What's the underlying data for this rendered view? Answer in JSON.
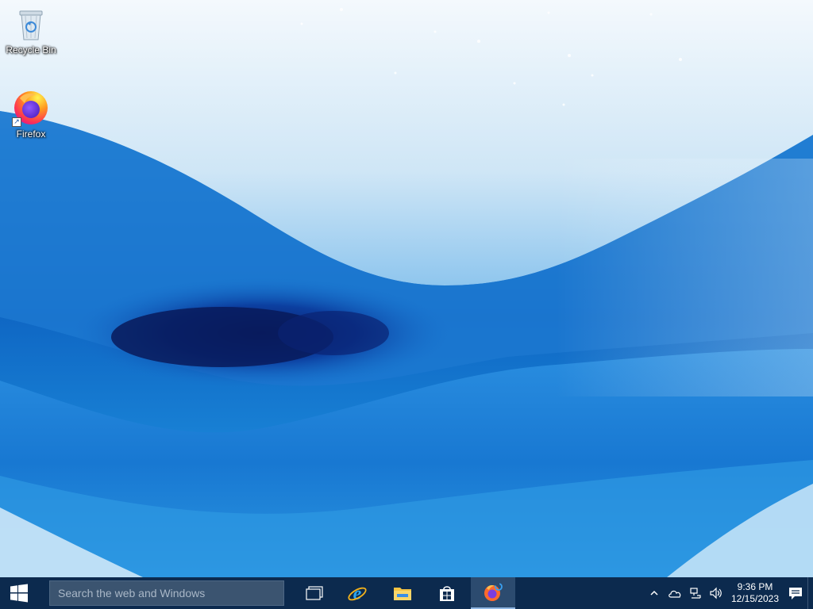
{
  "desktop": {
    "icons": [
      {
        "label": "Recycle Bin",
        "icon": "recycle-bin-icon"
      },
      {
        "label": "Firefox",
        "icon": "firefox-icon",
        "shortcut": true
      }
    ]
  },
  "taskbar": {
    "search": {
      "placeholder": "Search the web and Windows",
      "value": ""
    },
    "pinned_apps": [
      {
        "name": "Task View",
        "icon": "task-view-icon"
      },
      {
        "name": "Internet Explorer",
        "icon": "internet-explorer-icon"
      },
      {
        "name": "File Explorer",
        "icon": "file-explorer-icon"
      },
      {
        "name": "Store",
        "icon": "store-icon"
      },
      {
        "name": "Firefox",
        "icon": "firefox-icon",
        "active": true
      }
    ],
    "tray": {
      "icons": [
        "show-hidden-icons-chevron",
        "onedrive-icon",
        "network-icon",
        "volume-icon"
      ],
      "time": "9:36 PM",
      "date": "12/15/2023",
      "notification_icon": "action-center-icon"
    }
  },
  "colors": {
    "taskbar": "#0c2a4e",
    "search_box": "#3b5470",
    "accent": "#8fb6e3"
  }
}
